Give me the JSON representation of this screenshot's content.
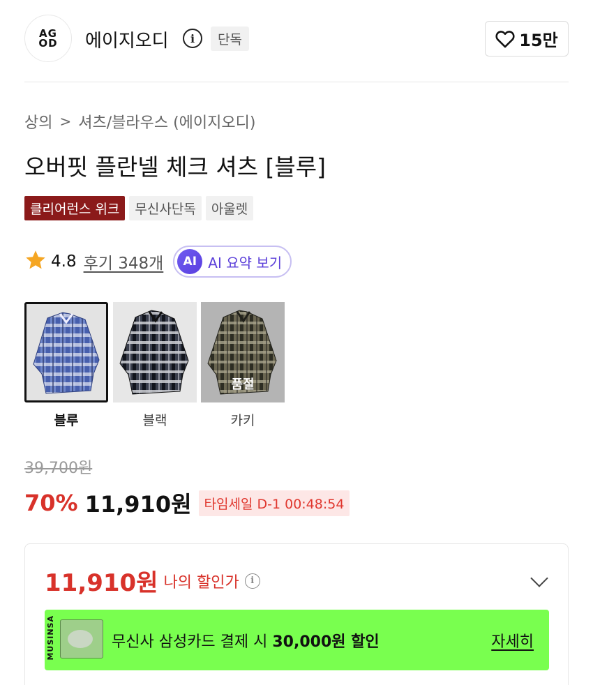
{
  "brand": {
    "logo_text_top": "AG",
    "logo_text_bottom": "OD",
    "name": "에이지오디",
    "exclusive_chip": "단독",
    "likes": "15만"
  },
  "breadcrumb": {
    "category": "상의",
    "separator": ">",
    "subcategory": "셔츠/블라우스 (에이지오디)"
  },
  "product": {
    "title": "오버핏 플란넬 체크 셔츠 [블루]",
    "tags": [
      "클리어런스 위크",
      "무신사단독",
      "아울렛"
    ]
  },
  "rating": {
    "score": "4.8",
    "reviews": "후기 348개",
    "ai_badge": "AI",
    "ai_label": "AI 요약 보기"
  },
  "colors": [
    {
      "label": "블루",
      "selected": true,
      "sold_out": false
    },
    {
      "label": "블랙",
      "selected": false,
      "sold_out": false
    },
    {
      "label": "카키",
      "selected": false,
      "sold_out": true,
      "sold_out_label": "품절"
    }
  ],
  "price": {
    "original": "39,700원",
    "discount": "70%",
    "final": "11,910원",
    "timesale": "타임세일 D-1 00:48:54"
  },
  "my_price": {
    "amount": "11,910원",
    "label": "나의 할인가"
  },
  "card_promo": {
    "image_text": "MUSINSA",
    "text_prefix": "무신사 삼성카드 결제 시 ",
    "text_bold": "30,000원 할인",
    "more": "자세히"
  },
  "colors_theme": {
    "accent_red": "#d8322a",
    "clearance_tag": "#8b1a1a",
    "promo_green": "#79ff4f",
    "ai_purple": "#5b3fd9",
    "star": "#f5a623"
  }
}
